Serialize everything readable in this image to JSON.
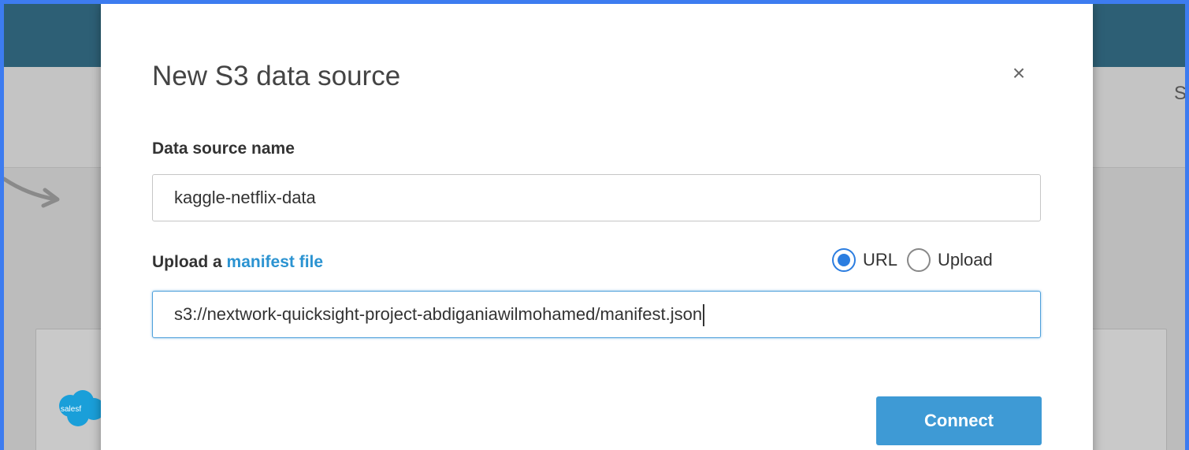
{
  "dialog": {
    "title": "New S3 data source",
    "close_glyph": "×",
    "name_label": "Data source name",
    "name_value": "kaggle-netflix-data",
    "upload_label_prefix": "Upload a",
    "upload_label_link": "manifest file",
    "source_options": [
      {
        "label": "URL",
        "selected": true
      },
      {
        "label": "Upload",
        "selected": false
      }
    ],
    "url_value": "s3://nextwork-quicksight-project-abdiganiawilmohamed/manifest.json",
    "connect_label": "Connect"
  },
  "background": {
    "right_edge_text": "S",
    "logo_text": "salesf"
  },
  "colors": {
    "accent": "#2b93d1",
    "button": "#3e9ad5",
    "topbar": "#2d5f75",
    "frame_border": "#3d7cf0"
  }
}
